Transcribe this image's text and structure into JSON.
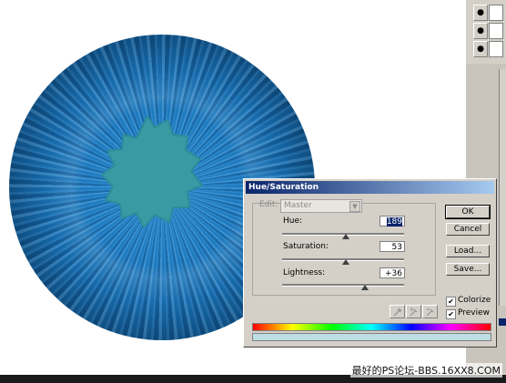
{
  "dialog": {
    "title": "Hue/Saturation",
    "edit_label": "Edit:",
    "edit_value": "Master",
    "hue": {
      "label": "Hue:",
      "value": "189",
      "fraction": 0.52
    },
    "saturation": {
      "label": "Saturation:",
      "value": "53",
      "fraction": 0.52
    },
    "lightness": {
      "label": "Lightness:",
      "value": "+36",
      "fraction": 0.68
    },
    "buttons": {
      "ok": "OK",
      "cancel": "Cancel",
      "load": "Load...",
      "save": "Save..."
    },
    "checkboxes": {
      "colorize": {
        "label": "Colorize",
        "checked": true
      },
      "preview": {
        "label": "Preview",
        "checked": true
      }
    },
    "eyedropper_icons": [
      "eyedropper-icon",
      "eyedropper-plus-icon",
      "eyedropper-minus-icon"
    ]
  },
  "colors": {
    "iris": "#1c77bb",
    "pupil": "#3a9aa4",
    "title_bar": "#0a246a",
    "dialog_face": "#d4d0c8",
    "result_bar": "#bcdde3"
  },
  "watermark": "最好的PS论坛-BBS.16XX8.COM"
}
